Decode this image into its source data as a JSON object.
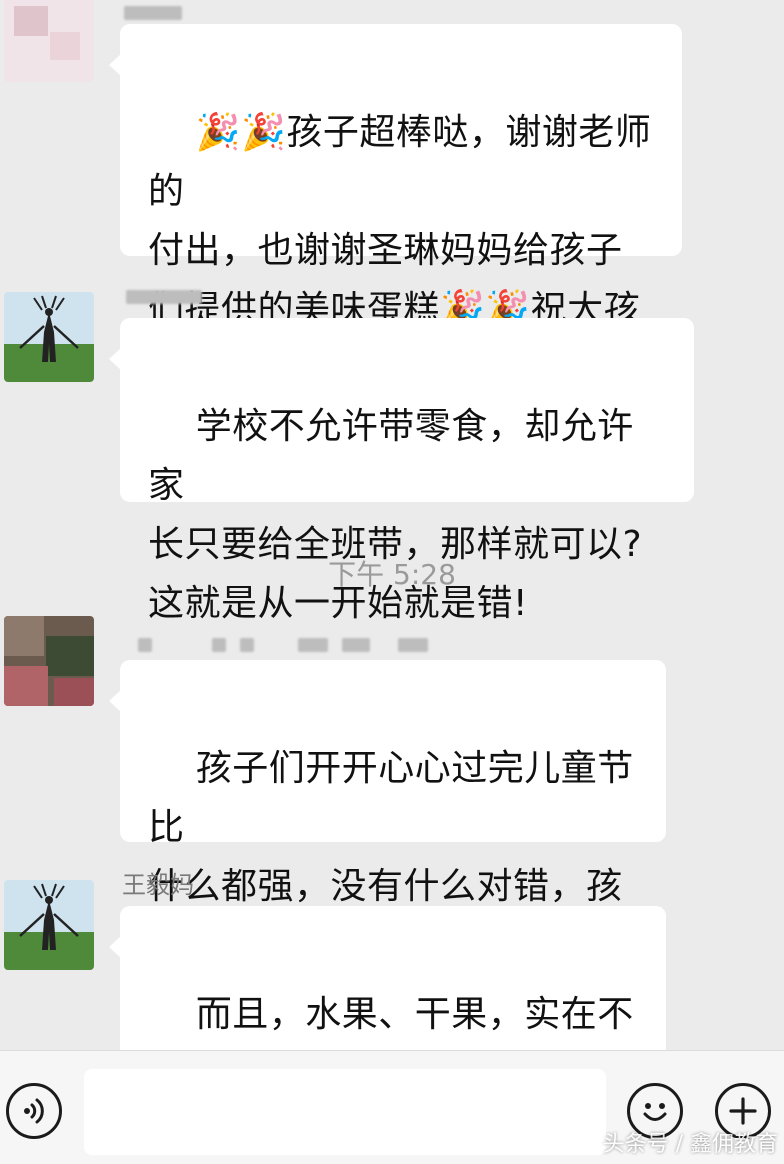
{
  "messages": [
    {
      "nickname": "",
      "text": "🎉🎉孩子超棒哒，谢谢老师的\n付出，也谢谢圣琳妈妈给孩子\n们提供的美味蛋糕🎉🎉祝大孩\n子，小孩子们节日快乐🎉🎉"
    },
    {
      "nickname": "",
      "text": "学校不允许带零食，却允许家\n长只要给全班带，那样就可以?\n这就是从一开始就是错!"
    },
    {
      "nickname": "",
      "text": "孩子们开开心心过完儿童节比\n什么都强，没有什么对错，孩\n子们开心最重要!"
    },
    {
      "nickname": "王毅妈",
      "text": "而且，水果、干果，实在不行\n瓜子，这些都可以。反式脂肪\n不健康就跟棒棒糖一样"
    }
  ],
  "timestamp": "下午 5:28",
  "input_bar": {
    "voice_icon": "voice-icon",
    "emoji_icon": "emoji-icon",
    "plus_icon": "plus-icon",
    "input_value": ""
  },
  "watermark": "头条号 / 鑫佣教育",
  "colors": {
    "background": "#ebebeb",
    "bubble": "#ffffff",
    "text": "#111111",
    "timestamp": "#9a9a9a"
  }
}
